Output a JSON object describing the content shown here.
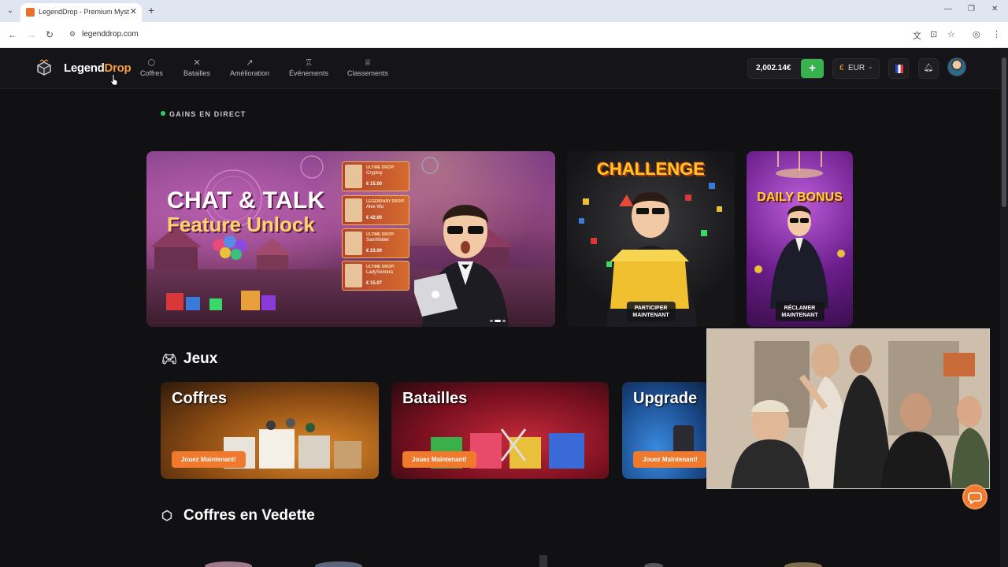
{
  "browser": {
    "tab_title": "LegendDrop - Premium Myster",
    "url": "legenddrop.com"
  },
  "nav": {
    "logo_primary": "Legend",
    "logo_accent": "Drop",
    "items": [
      {
        "label": "Coffres",
        "icon": "box-icon"
      },
      {
        "label": "Batailles",
        "icon": "swords-icon"
      },
      {
        "label": "Amélioration",
        "icon": "trend-up-icon"
      },
      {
        "label": "Événements",
        "icon": "trophy-icon"
      },
      {
        "label": "Classements",
        "icon": "crown-icon"
      }
    ],
    "balance": "2,002.14€",
    "add_label": "+",
    "currency_symbol": "€",
    "currency_code": "EUR"
  },
  "live_label": "GAINS EN DIRECT",
  "hero": {
    "title_line1": "CHAT & TALK",
    "title_line2": "Feature Unlock",
    "drops": [
      {
        "tag": "ULTIME DROP!",
        "name": "Cryptoy",
        "price": "€ 15.00"
      },
      {
        "tag": "LEGENDARY DROP!",
        "name": "Alex Wu",
        "price": "€ 42.00"
      },
      {
        "tag": "ULTIME DROP!",
        "name": "SamWallet",
        "price": "€ 23.00"
      },
      {
        "tag": "ULTIME DROP!",
        "name": "LadySemera",
        "price": "€ 15.07"
      }
    ]
  },
  "promos": {
    "challenge_title": "CHALLENGE",
    "challenge_button": "PARTICIPER\nMAINTENANT",
    "daily_title": "DAILY BONUS",
    "daily_button": "RÉCLAMER\nMAINTENANT"
  },
  "games_section": {
    "title": "Jeux",
    "cards": [
      {
        "title": "Coffres",
        "button": "Jouez Maintenant!"
      },
      {
        "title": "Batailles",
        "button": "Jouez Maintenant!"
      },
      {
        "title": "Upgrade",
        "button": "Jouez Maintenant!"
      }
    ]
  },
  "featured_section": {
    "title": "Coffres en Vedette"
  },
  "colors": {
    "accent_orange": "#f59a3c",
    "add_green": "#37b24d",
    "button_orange": "#ef7a2e",
    "live_green": "#2ecc71"
  }
}
